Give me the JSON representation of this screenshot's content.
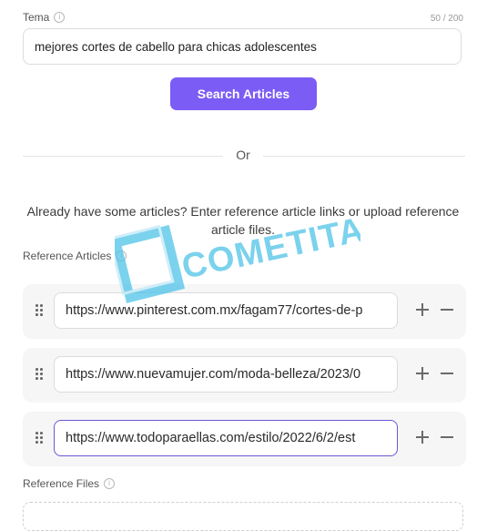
{
  "topic": {
    "label": "Tema",
    "counter": "50 / 200",
    "value": "mejores cortes de cabello para chicas adolescentes"
  },
  "search_button": {
    "label": "Search Articles"
  },
  "divider": {
    "text": "Or"
  },
  "hint": "Already have some articles? Enter reference article links or upload reference article files.",
  "reference_articles": {
    "label": "Reference Articles",
    "items": [
      {
        "url": "https://www.pinterest.com.mx/fagam77/cortes-de-p"
      },
      {
        "url": "https://www.nuevamujer.com/moda-belleza/2023/0"
      },
      {
        "url": "https://www.todoparaellas.com/estilo/2022/6/2/est"
      }
    ]
  },
  "reference_files": {
    "label": "Reference Files"
  },
  "watermark": {
    "text": "COMETITA",
    "color": "#4fc3e8"
  },
  "colors": {
    "accent": "#7b5cf5",
    "active_border": "#6e56d6"
  }
}
